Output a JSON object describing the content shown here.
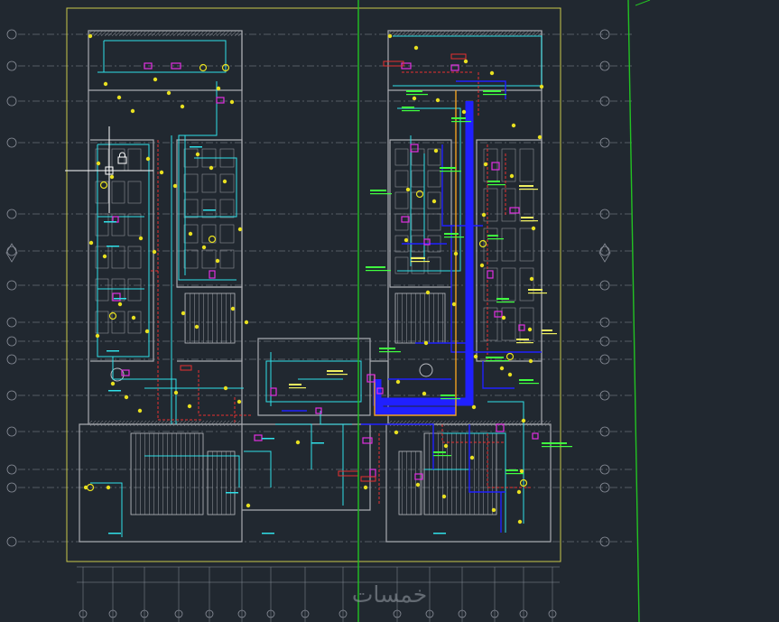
{
  "viewport": {
    "background": "#212830"
  },
  "colors": {
    "sheet_border": "#c9c84a",
    "grid_line": "#8a8f99",
    "wall": "#a8aab0",
    "cyan_wire": "#30e0e8",
    "red_wire": "#e83030",
    "blue_wire": "#2020ff",
    "green_line": "#22c222",
    "magenta_fixture": "#e030e0",
    "yellow_fixture": "#e8e020",
    "green_note": "#40ff40",
    "yellow_note": "#f0f060"
  },
  "icons": {
    "crosshair": "crosshair-cursor-icon",
    "lock": "lock-icon",
    "grid_bubble": "grid-bubble-icon",
    "section_marker": "section-marker-icon"
  },
  "watermark": {
    "text": "خمسات"
  }
}
